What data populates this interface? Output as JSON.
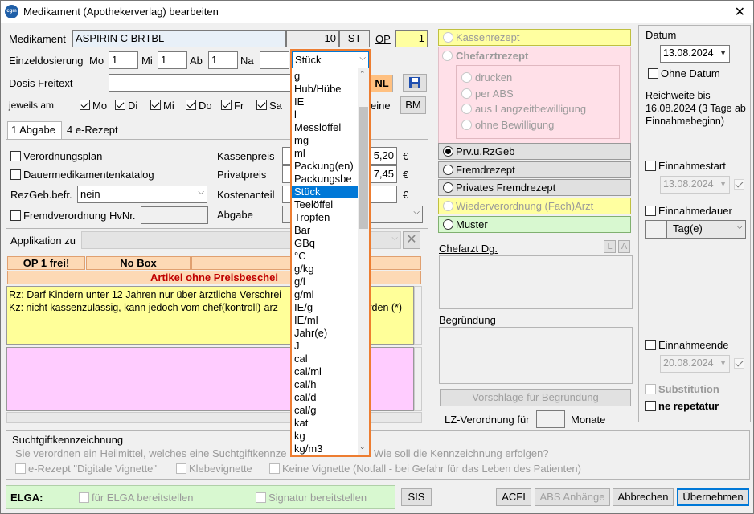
{
  "window": {
    "title": "Medikament (Apothekerverlag) bearbeiten",
    "close": "✕"
  },
  "medikament": {
    "label": "Medikament",
    "name": "ASPIRIN C BRTBL",
    "qty": "10",
    "unit": "ST",
    "op_label": "OP",
    "op_value": "1"
  },
  "dosierung": {
    "label": "Einzeldosierung",
    "mo_label": "Mo",
    "mo": "1",
    "mi_label": "Mi",
    "mi": "1",
    "ab_label": "Ab",
    "ab": "1",
    "na_label": "Na",
    "na": "",
    "unit_selected": "Stück"
  },
  "dosis_freitext": {
    "label": "Dosis Freitext",
    "value": "",
    "nl": "NL"
  },
  "jeweils": {
    "label": "jeweils am",
    "days": [
      "Mo",
      "Di",
      "Mi",
      "Do",
      "Fr",
      "Sa"
    ],
    "keine": "eine",
    "bm": "BM"
  },
  "tabs": [
    "1 Abgabe",
    "4 e-Rezept"
  ],
  "left": {
    "verordnungsplan": "Verordnungsplan",
    "dauer": "Dauermedikamentenkatalog",
    "rezgeb_label": "RezGeb.befr.",
    "rezgeb_value": "nein",
    "fremd": "Fremdverordnung HvNr.",
    "kassenpreis": "Kassenpreis",
    "kassenpreis_value": "5,20",
    "privatpreis": "Privatpreis",
    "privatpreis_value": "7,45",
    "kostenanteil": "Kostenanteil",
    "abgabe": "Abgabe",
    "euro": "€",
    "applikation": "Applikation zu"
  },
  "info": {
    "op_frei": "OP 1 frei!",
    "no_box": "No Box",
    "artikel": "Artikel ohne Preisbeschei",
    "rz_text": "Rz: Darf Kindern unter 12 Jahren nur über ärztliche Verschrei                 rden (10)\nKz: nicht kassenzulässig, kann jedoch vom chef(kontroll)-ärz                  willigt werden (*)"
  },
  "dropdown": {
    "items": [
      "g",
      "Hub/Hübe",
      "IE",
      "l",
      "Messlöffel",
      "mg",
      "ml",
      "Packung(en)",
      "Packungsbe",
      "Stück",
      "Teelöffel",
      "Tropfen",
      "Bar",
      "GBq",
      "°C",
      "g/kg",
      "g/l",
      "g/ml",
      "IE/g",
      "IE/ml",
      "Jahr(e)",
      "J",
      "cal",
      "cal/ml",
      "cal/h",
      "cal/d",
      "cal/g",
      "kat",
      "kg",
      "kg/m3"
    ],
    "active": "Stück"
  },
  "rezept": {
    "kassen": "Kassenrezept",
    "chefarzt": "Chefarztrezept",
    "drucken": "drucken",
    "per_abs": "per ABS",
    "langzeit": "aus Langzeitbewilligung",
    "ohne": "ohne Bewilligung",
    "prv": "Prv.u.RzGeb",
    "fremd": "Fremdrezept",
    "privates": "Privates Fremdrezept",
    "wieder": "Wiederverordnung (Fach)Arzt",
    "muster": "Muster"
  },
  "chefarzt_dg": {
    "label": "Chefarzt Dg.",
    "l": "L",
    "a": "A"
  },
  "begruendung": {
    "label": "Begründung",
    "vorschlaege": "Vorschläge für Begründung",
    "lz_label": "LZ-Verordnung für",
    "monate": "Monate"
  },
  "datum": {
    "label": "Datum",
    "value": "13.08.2024",
    "ohne": "Ohne Datum",
    "reichweite": "Reichweite bis 16.08.2024 (3 Tage ab Einnahmebeginn)",
    "einnahmestart": "Einnahmestart",
    "start_value": "13.08.2024",
    "einnahmedauer": "Einnahmedauer",
    "dauer_unit": "Tag(e)",
    "einnahmeende": "Einnahmeende",
    "ende_value": "20.08.2024",
    "substitution": "Substitution",
    "ne_repetatur": "ne repetatur"
  },
  "sucht": {
    "title": "Suchtgiftkennzeichnung",
    "text": "Sie verordnen ein Heilmittel, welches eine Suchtgiftkennze",
    "frage": "Wie soll die Kennzeichnung erfolgen?",
    "e_rezept": "e-Rezept \"Digitale Vignette\"",
    "klebe": "Klebevignette",
    "keine": "Keine Vignette (Notfall - bei Gefahr für das Leben des Patienten)"
  },
  "elga": {
    "label": "ELGA:",
    "bereit": "für ELGA bereitstellen",
    "signatur": "Signatur bereitstellen",
    "sis": "SIS"
  },
  "footer": {
    "acfi": "ACFI",
    "abs": "ABS Anhänge",
    "abbrechen": "Abbrechen",
    "uebernehmen": "Übernehmen"
  }
}
